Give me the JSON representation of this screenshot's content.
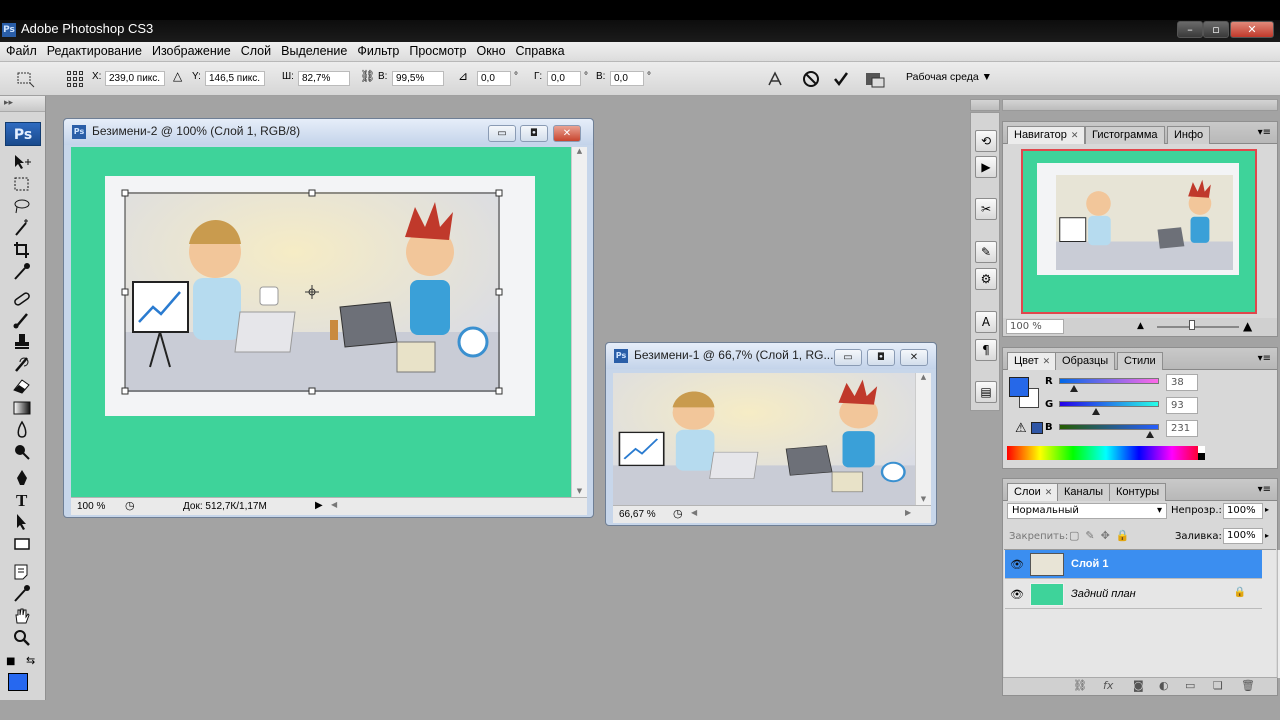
{
  "window": {
    "title": "Adobe Photoshop CS3",
    "icon": "ps-app-icon"
  },
  "menu": [
    "Файл",
    "Редактирование",
    "Изображение",
    "Слой",
    "Выделение",
    "Фильтр",
    "Просмотр",
    "Окно",
    "Справка"
  ],
  "options": {
    "x_label": "X:",
    "x_value": "239,0 пикс.",
    "y_label": "Y:",
    "y_value": "146,5 пикс.",
    "w_label": "Ш:",
    "w_value": "82,7%",
    "h_label": "В:",
    "h_value": "99,5%",
    "angle_value": "0,0",
    "angle_unit": "°",
    "hskew_label": "Г:",
    "hskew_value": "0,0",
    "hskew_unit": "°",
    "vskew_label": "В:",
    "vskew_value": "0,0",
    "vskew_unit": "°",
    "workspace": "Рабочая среда ▼"
  },
  "tools": {
    "logo": "Ps",
    "foreground_color": "#2668f0",
    "icons": [
      "move-icon",
      "marquee-icon",
      "lasso-icon",
      "magic-wand-icon",
      "crop-icon",
      "eyedropper-icon",
      "healing-brush-icon",
      "brush-icon",
      "clone-stamp-icon",
      "history-brush-icon",
      "eraser-icon",
      "gradient-icon",
      "blur-icon",
      "dodge-icon",
      "pen-icon",
      "type-icon",
      "path-select-icon",
      "rectangle-icon",
      "notes-icon",
      "eyedropper2-icon",
      "hand-icon",
      "zoom-icon"
    ]
  },
  "doc1": {
    "title": "Безимени-2 @ 100% (Слой 1, RGB/8)",
    "zoom": "100 %",
    "doc_info": "Док: 512,7К/1,17М"
  },
  "doc2": {
    "title": "Безимени-1 @ 66,7% (Слой 1, RG...",
    "zoom": "66,67 %"
  },
  "navigator": {
    "tabs": [
      "Навигатор",
      "Гистограмма",
      "Инфо"
    ],
    "zoom": "100 %"
  },
  "color": {
    "tabs": [
      "Цвет",
      "Образцы",
      "Стили"
    ],
    "swatch": "#2668e8",
    "channels": [
      {
        "label": "R",
        "value": "38",
        "fraction": 0.149
      },
      {
        "label": "G",
        "value": "93",
        "fraction": 0.365
      },
      {
        "label": "B",
        "value": "231",
        "fraction": 0.906
      }
    ]
  },
  "layers": {
    "tabs": [
      "Слои",
      "Каналы",
      "Контуры"
    ],
    "blend_mode": "Нормальный",
    "opacity_label": "Непрозр.:",
    "opacity_value": "100%",
    "lock_label": "Закрепить:",
    "fill_label": "Заливка:",
    "fill_value": "100%",
    "items": [
      {
        "name": "Слой 1",
        "selected": true
      },
      {
        "name": "Задний план",
        "selected": false
      }
    ]
  }
}
